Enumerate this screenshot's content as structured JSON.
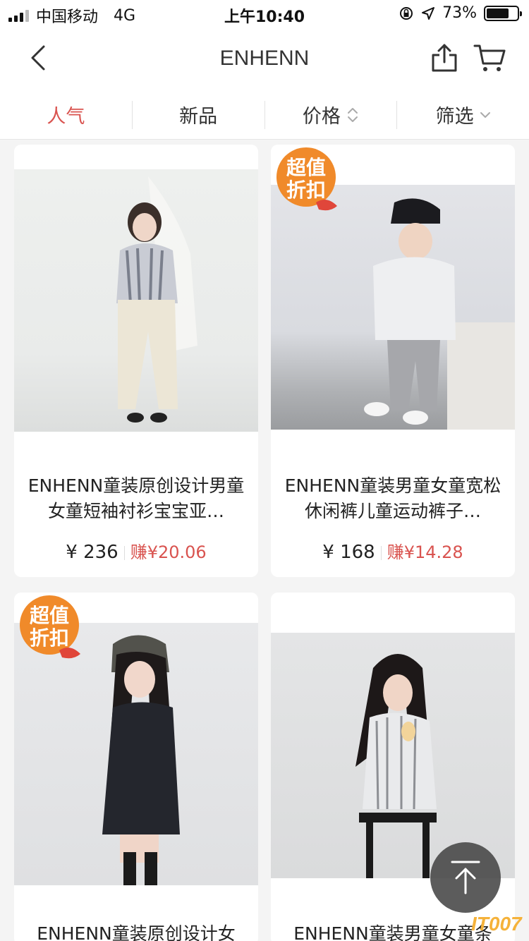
{
  "status_bar": {
    "carrier": "中国移动",
    "network": "4G",
    "time": "上午10:40",
    "battery": "73%",
    "battery_level": 0.73
  },
  "nav": {
    "title": "ENHENN",
    "back_icon": "chevron-left-icon",
    "share_icon": "share-icon",
    "cart_icon": "cart-icon"
  },
  "filters": {
    "tabs": [
      {
        "label": "人气",
        "active": true
      },
      {
        "label": "新品",
        "active": false
      },
      {
        "label": "价格",
        "active": false,
        "icon": "sort-icon"
      },
      {
        "label": "筛选",
        "active": false,
        "icon": "chevron-down-icon"
      }
    ]
  },
  "colors": {
    "accent": "#d9534f",
    "badge_orange": "#f08a2a",
    "background": "#f4f4f4"
  },
  "badge": {
    "line1": "超值",
    "line2": "折扣"
  },
  "products": [
    {
      "title": "ENHENN童装原创设计男童女童短袖衬衫宝宝亚…",
      "price": "¥ 236",
      "earn": "赚¥20.06",
      "badge": false
    },
    {
      "title": "ENHENN童装男童女童宽松休闲裤儿童运动裤子…",
      "price": "¥ 168",
      "earn": "赚¥14.28",
      "badge": true
    },
    {
      "title": "ENHENN童装原创设计女",
      "badge": true
    },
    {
      "title": "ENHENN童装男童女童条",
      "badge": false
    }
  ],
  "back_to_top_icon": "arrow-up-icon",
  "watermark": "IT007"
}
